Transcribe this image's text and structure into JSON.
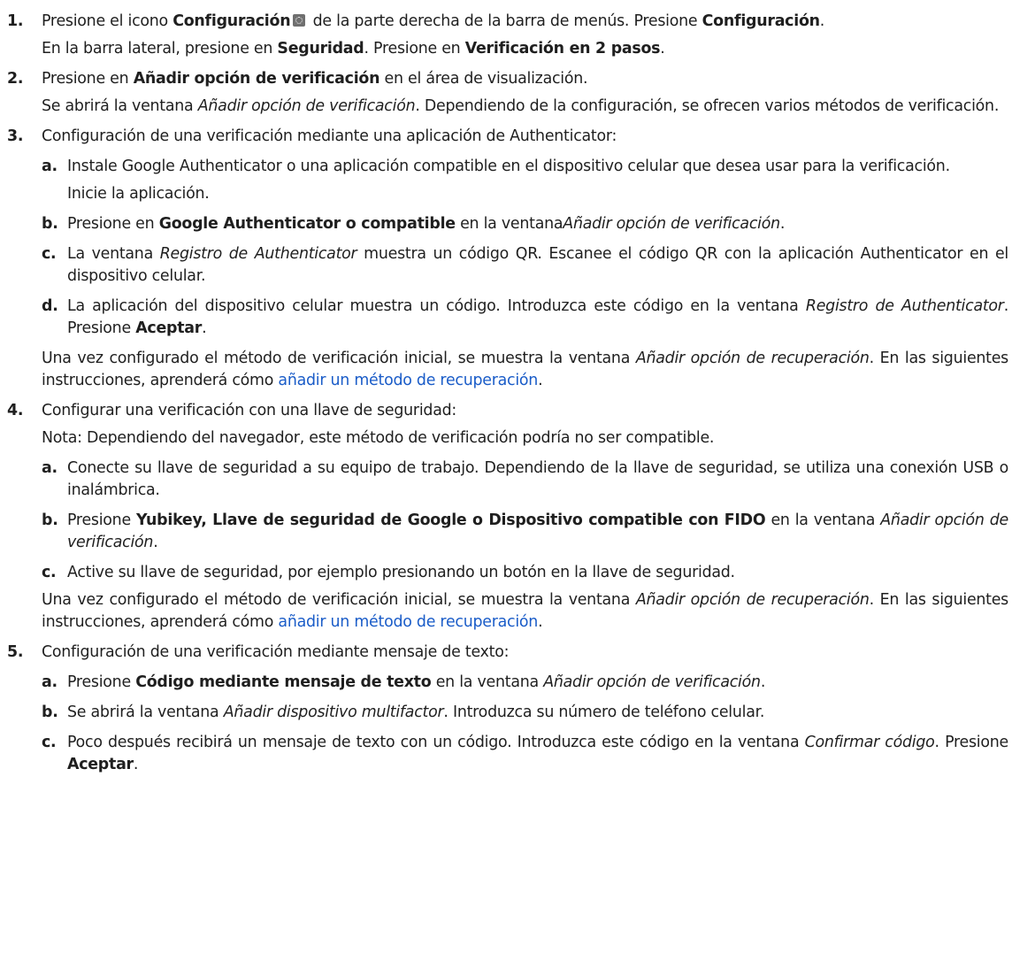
{
  "s1": {
    "num": "1.",
    "t1": "Presione el icono ",
    "b1": "Configuración",
    "icon": "gear-icon",
    "t2": " de la parte derecha de la barra de menús. Presione ",
    "b2": "Configuración",
    "t3": ".",
    "l2t1": "En la barra lateral, presione en ",
    "l2b1": "Seguridad",
    "l2t2": ". Presione en ",
    "l2b2": "Verificación en 2 pasos",
    "l2t3": "."
  },
  "s2": {
    "num": "2.",
    "t1": "Presione en ",
    "b1": "Añadir opción de verificación",
    "t2": " en el área de visualización.",
    "p2t1": "Se abrirá la ventana ",
    "p2i1": "Añadir opción de verificación",
    "p2t2": ". Dependiendo de la configuración, se ofrecen varios métodos de verificación."
  },
  "s3": {
    "num": "3.",
    "t1": "Configuración de una verificación mediante una aplicación de Authenticator:",
    "a": {
      "num": "a.",
      "t1": "Instale Google Authenticator o una aplicación compatible en el dispositivo celular que desea usar para la verificación.",
      "t2": "Inicie la aplicación."
    },
    "b": {
      "num": "b.",
      "t1": "Presione en ",
      "b1": "Google Authenticator o compatible",
      "t2": " en la ventana",
      "i1": "Añadir opción de verificación",
      "t3": "."
    },
    "c": {
      "num": "c.",
      "t1": "La ventana ",
      "i1": "Registro de Authenticator",
      "t2": " muestra un código QR. Escanee el código QR con la aplicación Authenticator en el dispositivo celular."
    },
    "d": {
      "num": "d.",
      "t1": "La aplicación del dispositivo celular muestra un código. Introduzca este código en la ventana ",
      "i1": "Registro de Authenticator",
      "t2": ". Presione ",
      "b1": "Aceptar",
      "t3": "."
    },
    "after": {
      "t1": "Una vez configurado el método de verificación inicial, se muestra la ventana ",
      "i1": "Añadir opción de recuperación",
      "t2": ". En las siguientes instrucciones, aprenderá cómo ",
      "link": "añadir un método de recuperación",
      "t3": "."
    }
  },
  "s4": {
    "num": "4.",
    "t1": "Configurar una verificación con una llave de seguridad:",
    "note": "Nota: Dependiendo del navegador, este método de verificación podría no ser compatible.",
    "a": {
      "num": "a.",
      "t1": "Conecte su llave de seguridad a su equipo de trabajo. Dependiendo de la llave de seguridad, se utiliza una conexión USB o inalámbrica."
    },
    "b": {
      "num": "b.",
      "t1": "Presione ",
      "b1": "Yubikey, Llave de seguridad de Google o Dispositivo compatible con FIDO",
      "t2": " en la ventana ",
      "i1": "Añadir opción de verificación",
      "t3": "."
    },
    "c": {
      "num": "c.",
      "t1": "Active su llave de seguridad, por ejemplo presionando un botón en la llave de seguridad."
    },
    "after": {
      "t1": "Una vez configurado el método de verificación inicial, se muestra la ventana ",
      "i1": "Añadir opción de recuperación",
      "t2": ". En las siguientes instrucciones, aprenderá cómo ",
      "link": "añadir un método de recuperación",
      "t3": "."
    }
  },
  "s5": {
    "num": "5.",
    "t1": "Configuración de una verificación mediante mensaje de texto:",
    "a": {
      "num": "a.",
      "t1": "Presione ",
      "b1": "Código mediante mensaje de texto",
      "t2": " en la ventana ",
      "i1": "Añadir opción de verificación",
      "t3": "."
    },
    "b": {
      "num": "b.",
      "t1": "Se abrirá la ventana ",
      "i1": "Añadir dispositivo multifactor",
      "t2": ". Introduzca su número de teléfono celular."
    },
    "c": {
      "num": "c.",
      "t1": "Poco después recibirá un mensaje de texto con un código. Introduzca este código en la ventana ",
      "i1": "Confirmar código",
      "t2": ". Presione ",
      "b1": "Aceptar",
      "t3": "."
    }
  }
}
